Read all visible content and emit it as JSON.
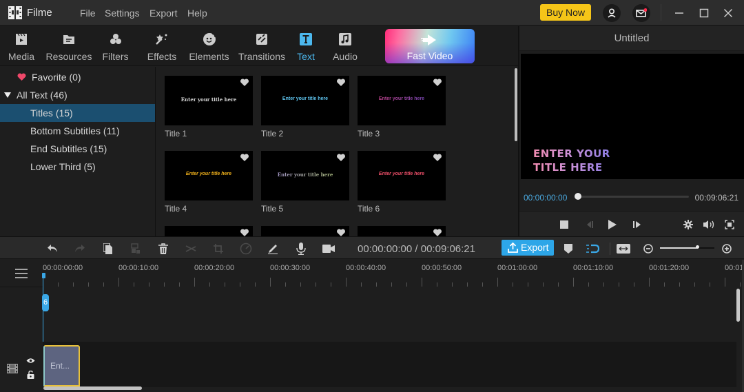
{
  "app": {
    "name": "Filme"
  },
  "menu": [
    "File",
    "Settings",
    "Export",
    "Help"
  ],
  "titlebar": {
    "buy_now": "Buy Now",
    "account_icon": "user-icon",
    "mail_icon": "mail-icon",
    "mail_badge_color": "#ff2a4a"
  },
  "toolbar": {
    "tools": [
      {
        "label": "Media",
        "icon": "clapperboard-icon"
      },
      {
        "label": "Resources",
        "icon": "folder-icon"
      },
      {
        "label": "Filters",
        "icon": "filters-icon"
      },
      {
        "label": "Effects",
        "icon": "magic-wand-icon"
      },
      {
        "label": "Elements",
        "icon": "smiley-sticker-icon"
      },
      {
        "label": "Transitions",
        "icon": "transition-icon"
      },
      {
        "label": "Text",
        "icon": "text-icon",
        "active": true
      },
      {
        "label": "Audio",
        "icon": "music-icon"
      }
    ],
    "fast_video": "Fast Video",
    "active_color": "#4cb8ee"
  },
  "sidebar": {
    "favorite": "Favorite (0)",
    "all_text": "All Text (46)",
    "items": [
      {
        "label": "Titles (15)",
        "selected": true
      },
      {
        "label": "Bottom Subtitles (11)"
      },
      {
        "label": "End Subtitles (15)"
      },
      {
        "label": "Lower Third (5)"
      }
    ]
  },
  "templates": [
    {
      "label": "Title 1",
      "preview": "Enter your title here",
      "color": "#d8d8d8"
    },
    {
      "label": "Title 2",
      "preview": "Enter your title here",
      "color": "#5ec4ef"
    },
    {
      "label": "Title 3",
      "preview": "Enter your title here",
      "color": "#b14a9a"
    },
    {
      "label": "Title 4",
      "preview": "Enter your title here",
      "color": "#f2b21b"
    },
    {
      "label": "Title 5",
      "preview": "Enter your title here",
      "color": "#9a86d0"
    },
    {
      "label": "Title 6",
      "preview": "Enter your title here",
      "color": "#f0506a"
    }
  ],
  "preview": {
    "title": "Untitled",
    "text_line1": "ENTER YOUR",
    "text_line2": "TITLE HERE",
    "current_time": "00:00:00:00",
    "total_time": "00:09:06:21",
    "progress": 0
  },
  "timeline_toolbar": {
    "time_display": "00:00:00:00 / 00:09:06:21",
    "export_label": "Export",
    "zoom_level": 0.68
  },
  "timeline": {
    "ruler_labels": [
      "00:00:00:00",
      "00:00:10:00",
      "00:00:20:00",
      "00:00:30:00",
      "00:00:40:00",
      "00:00:50:00",
      "00:01:00:00",
      "00:01:10:00",
      "00:01:20:00",
      "00:01:"
    ],
    "playhead_marker": "6",
    "clip_label": "Ent..."
  }
}
